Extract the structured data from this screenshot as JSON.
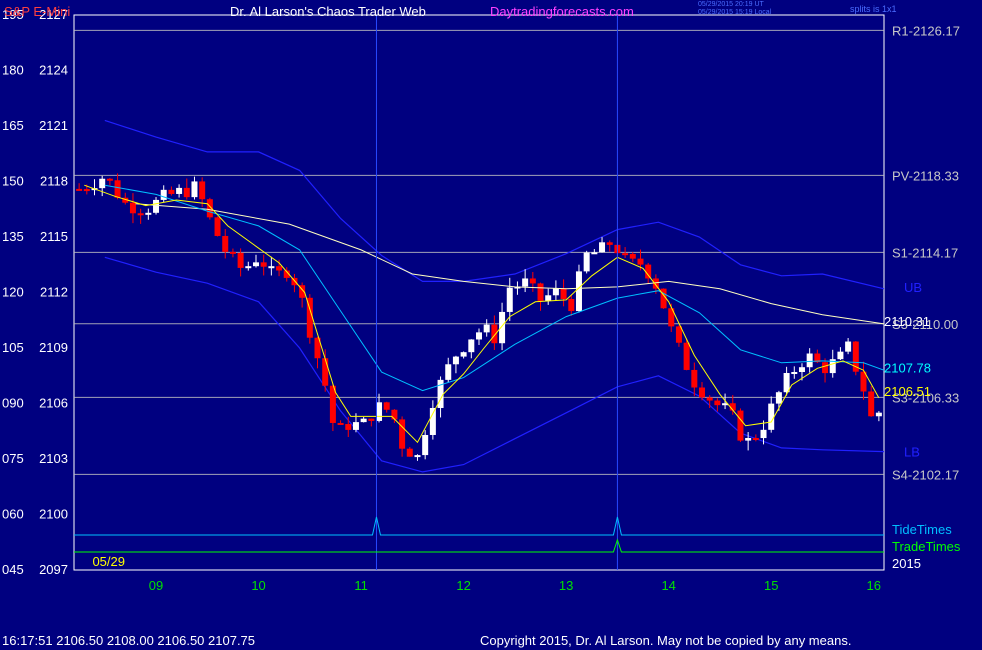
{
  "header": {
    "symbol": "S&P E-Mini",
    "title": "Dr. Al Larson's Chaos Trader Web",
    "site": "Daytradingforecasts.com",
    "timestamp_ut": "05/29/2015 20:19 UT",
    "timestamp_local": "05/29/2015 15:19 Local",
    "split": "splits is 1x1"
  },
  "footer": {
    "quote": "16:17:51  2106.50 2108.00 2106.50 2107.75",
    "copyright": "Copyright 2015, Dr. Al Larson. May not be copied by any means."
  },
  "colors": {
    "background": "#000080",
    "bar_up": "#ffffff",
    "bar_down": "#ff0000",
    "ma_fast": "#ffff00",
    "ma_slow": "#00c0ff",
    "ma_long": "#ffffc0",
    "band": "#2020ff",
    "level_line": "#c0c0c0",
    "tide": "#00bfff",
    "trade": "#00ff00"
  },
  "chart_data": {
    "type": "candlestick",
    "y_price_range": [
      2097,
      2127
    ],
    "y_price_ticks": [
      "2127",
      "2124",
      "2121",
      "2118",
      "2115",
      "2112",
      "2109",
      "2106",
      "2103",
      "2100",
      "2097"
    ],
    "y_alt_ticks": [
      "195",
      "180",
      "165",
      "150",
      "135",
      "120",
      "105",
      "090",
      "075",
      "060",
      "045"
    ],
    "x_ticks": [
      "09",
      "10",
      "11",
      "12",
      "13",
      "14",
      "15",
      "16"
    ],
    "x_range": [
      8.2,
      16.1
    ],
    "date_label": "05/29",
    "year_label": "2015",
    "levels": [
      {
        "label": "R1-2126.17",
        "price": 2126.17
      },
      {
        "label": "PV-2118.33",
        "price": 2118.33
      },
      {
        "label": "S1-2114.17",
        "price": 2114.17
      },
      {
        "label": "S3-2110.00",
        "price": 2110.31
      },
      {
        "label": "S3-2106.33",
        "price": 2106.33
      },
      {
        "label": "S4-2102.17",
        "price": 2102.17
      }
    ],
    "annotations": [
      {
        "label": "2110.31",
        "price": 2110.31
      },
      {
        "label": "2107.78",
        "price": 2107.78
      },
      {
        "label": "2106.51",
        "price": 2106.51
      }
    ],
    "band_labels": [
      {
        "label": "UB",
        "price": 2112.3
      },
      {
        "label": "LB",
        "price": 2103.4
      }
    ],
    "tide_label": "TideTimes",
    "trade_label": "TradeTimes",
    "tide_times": [
      11.15,
      13.5
    ],
    "trade_times": [
      13.5
    ],
    "ohlc_anchor_path": [
      [
        8.25,
        2117.6
      ],
      [
        8.5,
        2118.3
      ],
      [
        8.7,
        2116.8
      ],
      [
        8.9,
        2116.5
      ],
      [
        9.1,
        2117.2
      ],
      [
        9.4,
        2117.7
      ],
      [
        9.5,
        2116.2
      ],
      [
        9.7,
        2114.0
      ],
      [
        9.85,
        2113.2
      ],
      [
        10.0,
        2114.0
      ],
      [
        10.15,
        2112.8
      ],
      [
        10.3,
        2113.3
      ],
      [
        10.4,
        2112.0
      ],
      [
        10.55,
        2109.0
      ],
      [
        10.65,
        2107.0
      ],
      [
        10.75,
        2104.3
      ],
      [
        10.9,
        2105.0
      ],
      [
        11.0,
        2104.7
      ],
      [
        11.15,
        2105.8
      ],
      [
        11.3,
        2105.6
      ],
      [
        11.4,
        2103.8
      ],
      [
        11.55,
        2103.1
      ],
      [
        11.7,
        2106.2
      ],
      [
        11.9,
        2108.5
      ],
      [
        12.1,
        2109.8
      ],
      [
        12.2,
        2110.0
      ],
      [
        12.3,
        2109.6
      ],
      [
        12.45,
        2112.3
      ],
      [
        12.6,
        2112.5
      ],
      [
        12.75,
        2111.6
      ],
      [
        12.9,
        2112.0
      ],
      [
        13.05,
        2111.4
      ],
      [
        13.2,
        2114.0
      ],
      [
        13.35,
        2114.3
      ],
      [
        13.45,
        2114.8
      ],
      [
        13.6,
        2113.5
      ],
      [
        13.75,
        2113.6
      ],
      [
        13.9,
        2112.2
      ],
      [
        14.05,
        2109.5
      ],
      [
        14.25,
        2107.2
      ],
      [
        14.45,
        2106.0
      ],
      [
        14.6,
        2105.5
      ],
      [
        14.75,
        2103.8
      ],
      [
        14.9,
        2104.6
      ],
      [
        15.05,
        2106.3
      ],
      [
        15.2,
        2107.7
      ],
      [
        15.35,
        2108.6
      ],
      [
        15.5,
        2107.9
      ],
      [
        15.65,
        2108.3
      ],
      [
        15.75,
        2109.0
      ],
      [
        15.85,
        2107.6
      ],
      [
        15.93,
        2106.3
      ],
      [
        16.0,
        2104.6
      ],
      [
        16.08,
        2106.1
      ]
    ],
    "ma_fast_path": [
      [
        8.0,
        2119.0
      ],
      [
        8.3,
        2117.8
      ],
      [
        8.6,
        2117.2
      ],
      [
        8.9,
        2116.7
      ],
      [
        9.2,
        2117.0
      ],
      [
        9.5,
        2116.8
      ],
      [
        9.7,
        2115.6
      ],
      [
        9.95,
        2114.6
      ],
      [
        10.2,
        2113.6
      ],
      [
        10.45,
        2112.0
      ],
      [
        10.6,
        2109.3
      ],
      [
        10.75,
        2106.6
      ],
      [
        10.9,
        2105.3
      ],
      [
        11.1,
        2105.3
      ],
      [
        11.3,
        2105.3
      ],
      [
        11.55,
        2103.9
      ],
      [
        11.8,
        2106.5
      ],
      [
        12.0,
        2107.6
      ],
      [
        12.2,
        2109.0
      ],
      [
        12.45,
        2110.7
      ],
      [
        12.7,
        2111.5
      ],
      [
        13.0,
        2111.6
      ],
      [
        13.25,
        2112.9
      ],
      [
        13.5,
        2113.9
      ],
      [
        13.75,
        2113.3
      ],
      [
        14.0,
        2111.5
      ],
      [
        14.25,
        2108.6
      ],
      [
        14.5,
        2106.5
      ],
      [
        14.75,
        2104.8
      ],
      [
        15.0,
        2105.0
      ],
      [
        15.2,
        2107.0
      ],
      [
        15.45,
        2107.9
      ],
      [
        15.7,
        2108.3
      ],
      [
        15.9,
        2107.8
      ],
      [
        16.05,
        2106.3
      ]
    ],
    "ma_slow_path": [
      [
        8.0,
        2117.8
      ],
      [
        8.5,
        2117.8
      ],
      [
        9.0,
        2117.3
      ],
      [
        9.5,
        2116.4
      ],
      [
        10.0,
        2115.6
      ],
      [
        10.4,
        2114.3
      ],
      [
        10.8,
        2111.0
      ],
      [
        11.2,
        2107.7
      ],
      [
        11.6,
        2106.7
      ],
      [
        12.0,
        2107.4
      ],
      [
        12.5,
        2109.2
      ],
      [
        13.0,
        2110.7
      ],
      [
        13.5,
        2111.7
      ],
      [
        13.9,
        2112.1
      ],
      [
        14.3,
        2110.9
      ],
      [
        14.7,
        2108.9
      ],
      [
        15.1,
        2108.2
      ],
      [
        15.5,
        2108.3
      ],
      [
        15.9,
        2108.2
      ],
      [
        16.1,
        2107.8
      ]
    ],
    "ma_long_path": [
      [
        8.0,
        2116.7
      ],
      [
        8.8,
        2116.8
      ],
      [
        9.5,
        2116.5
      ],
      [
        10.3,
        2115.7
      ],
      [
        11.0,
        2114.3
      ],
      [
        11.5,
        2113.0
      ],
      [
        12.0,
        2112.6
      ],
      [
        12.5,
        2112.3
      ],
      [
        13.0,
        2112.2
      ],
      [
        13.5,
        2112.3
      ],
      [
        14.0,
        2112.6
      ],
      [
        14.5,
        2112.2
      ],
      [
        15.0,
        2111.4
      ],
      [
        15.5,
        2110.8
      ],
      [
        16.1,
        2110.3
      ]
    ],
    "upper_band_path": [
      [
        8.0,
        2121.6
      ],
      [
        8.5,
        2121.3
      ],
      [
        9.0,
        2120.4
      ],
      [
        9.5,
        2119.6
      ],
      [
        10.0,
        2119.6
      ],
      [
        10.4,
        2118.6
      ],
      [
        10.8,
        2116.0
      ],
      [
        11.2,
        2114.0
      ],
      [
        11.6,
        2112.6
      ],
      [
        12.0,
        2112.6
      ],
      [
        12.5,
        2113.0
      ],
      [
        13.0,
        2114.1
      ],
      [
        13.5,
        2115.4
      ],
      [
        13.9,
        2115.8
      ],
      [
        14.3,
        2115.0
      ],
      [
        14.7,
        2113.5
      ],
      [
        15.1,
        2112.9
      ],
      [
        15.5,
        2113.0
      ],
      [
        16.1,
        2112.2
      ]
    ],
    "lower_band_path": [
      [
        8.0,
        2114.0
      ],
      [
        8.5,
        2113.9
      ],
      [
        9.0,
        2113.1
      ],
      [
        9.5,
        2112.5
      ],
      [
        10.0,
        2111.5
      ],
      [
        10.4,
        2109.0
      ],
      [
        10.8,
        2105.6
      ],
      [
        11.2,
        2102.9
      ],
      [
        11.6,
        2102.3
      ],
      [
        12.0,
        2102.7
      ],
      [
        12.5,
        2104.1
      ],
      [
        13.0,
        2105.5
      ],
      [
        13.5,
        2106.9
      ],
      [
        13.9,
        2107.5
      ],
      [
        14.3,
        2106.4
      ],
      [
        14.7,
        2104.4
      ],
      [
        15.1,
        2103.6
      ],
      [
        15.5,
        2103.5
      ],
      [
        16.1,
        2103.4
      ]
    ]
  }
}
